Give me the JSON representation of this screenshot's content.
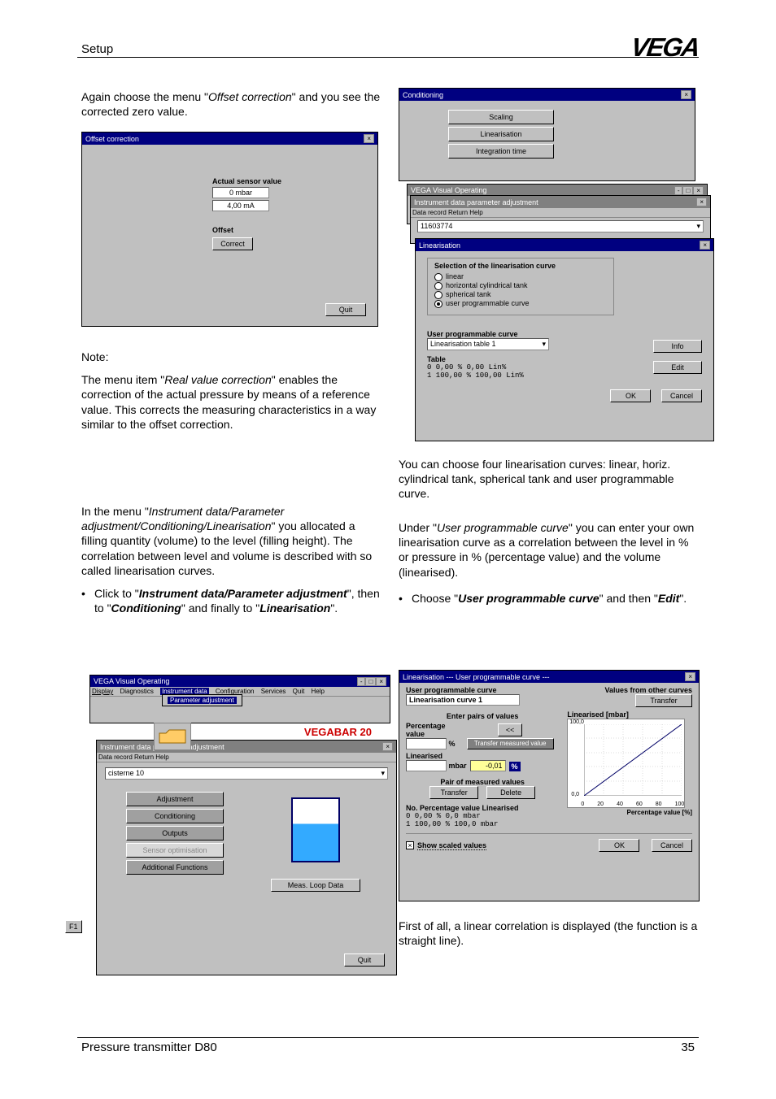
{
  "header": {
    "title": "Setup",
    "brand": "VEGA"
  },
  "leftCol": {
    "para1_a": "Again choose the menu \"",
    "para1_i": "Offset correction",
    "para1_b": "\" and you see the corrected zero value.",
    "win1": {
      "title": "Offset correction",
      "label_actual": "Actual sensor value",
      "val1": "0 mbar",
      "val2": "4,00 mA",
      "label_offset": "Offset",
      "btn_correct": "Correct",
      "btn_quit": "Quit"
    },
    "note": "Note:",
    "note_a": "The menu item \"",
    "note_i": "Real value correction",
    "note_b": "\" enables the correction of the actual pressure by means of a reference value. This corrects the measuring characteristics in a way similar to the offset correction.",
    "para2_a": "In the menu \"",
    "para2_i": "Instrument data/Parameter adjustment/Conditioning/Linearisation",
    "para2_b": "\" you allocated a filling quantity (volume) to the level (filling height). The correlation between level and volume is described with so called linearisation curves.",
    "bullet_a": "Click to \"",
    "bullet_i1": "Instrument data/Parameter adjustment",
    "bullet_b": "\", then to \"",
    "bullet_i2": "Conditioning",
    "bullet_c": "\" and finally to \"",
    "bullet_i3": "Linearisation",
    "bullet_d": "\".",
    "win2": {
      "title1": "VEGA Visual Operating",
      "menu": [
        "Display",
        "Diagnostics",
        "Instrument data",
        "Configuration",
        "Services",
        "Quit",
        "Help"
      ],
      "menu_item": "Parameter adjustment",
      "title2": "Instrument data parameter adjustment",
      "menu2": "Data record   Return   Help",
      "field_sensor": "cisterne 10",
      "product": "VEGABAR 20",
      "btns": [
        "Adjustment",
        "Conditioning",
        "Outputs",
        "Sensor optimisation",
        "Additional Functions"
      ],
      "btn_data": "Meas. Loop Data",
      "btn_f1": "F1",
      "btn_quit": "Quit"
    }
  },
  "rightCol": {
    "win3": {
      "title1": "Conditioning",
      "btns_top": [
        "Scaling",
        "Linearisation",
        "Integration time"
      ],
      "title_vvo": "VEGA Visual Operating",
      "title2": "Instrument data parameter adjustment",
      "menu2": "Data record   Return   Help",
      "sensor_id": "11603774",
      "title_lin": "Linearisation",
      "group_label": "Selection of the linearisation curve",
      "radios": [
        "linear",
        "horizontal cylindrical tank",
        "spherical tank",
        "user programmable curve"
      ],
      "upc_label": "User programmable curve",
      "dropdown": "Linearisation table 1",
      "table_label": "Table",
      "table_rows": [
        "0     0,00 %    0,00 Lin%",
        "1   100,00 %  100,00 Lin%"
      ],
      "btn_info": "Info",
      "btn_edit": "Edit",
      "btn_ok": "OK",
      "btn_cancel": "Cancel"
    },
    "para3": "You can choose four linearisation curves: linear, horiz. cylindrical tank, spherical tank and user programmable curve.",
    "para4_a": "Under \"",
    "para4_i": "User programmable curve",
    "para4_b": "\" you can enter your own linearisation curve as a correlation between the level in % or pressure in % (percentage value) and the volume (linearised).",
    "bullet2_a": "Choose \"",
    "bullet2_i1": "User programmable curve",
    "bullet2_b": "\" and then \"",
    "bullet2_i2": "Edit",
    "bullet2_c": "\".",
    "win4": {
      "title": "Linearisation      ---  User programmable curve  ---",
      "upc": "User programmable curve",
      "curve": "Linearisation curve 1",
      "values_other": "Values from other curves",
      "btn_transfer_top": "Transfer",
      "enter_pairs": "Enter pairs of values",
      "pct_label": "Percentage value",
      "pct_unit": "%",
      "btn_arrows": "<<",
      "btn_tmv": "Transfer measured value",
      "lin_label": "Linearised",
      "lin_unit": "mbar",
      "lin_val": "-0,01",
      "lin_unit2": "%",
      "pair_label": "Pair of measured values",
      "btn_transfer": "Transfer",
      "btn_delete": "Delete",
      "table_hdr": "No.  Percentage value   Linearised",
      "table_rows": [
        "0      0,00 %       0,0 mbar",
        "1    100,00 %     100,0 mbar"
      ],
      "chart_title": "Linearised [mbar]",
      "chart_ymax": "100,0",
      "chart_ymin": "0,0",
      "chart_xticks": [
        "0",
        "20",
        "40",
        "60",
        "80",
        "100"
      ],
      "chart_xlabel": "Percentage value [%]",
      "check_label": "Show scaled values",
      "btn_ok": "OK",
      "btn_cancel": "Cancel"
    },
    "para5": "First of all, a linear correlation is displayed (the function is a straight line)."
  },
  "footer": {
    "left": "Pressure transmitter D80",
    "right": "35"
  },
  "chart_data": {
    "type": "line",
    "title": "Linearised [mbar]",
    "xlabel": "Percentage value [%]",
    "ylabel": "Linearised [mbar]",
    "x": [
      0,
      20,
      40,
      60,
      80,
      100
    ],
    "y": [
      0,
      20,
      40,
      60,
      80,
      100
    ],
    "xlim": [
      0,
      100
    ],
    "ylim": [
      0,
      100
    ]
  }
}
